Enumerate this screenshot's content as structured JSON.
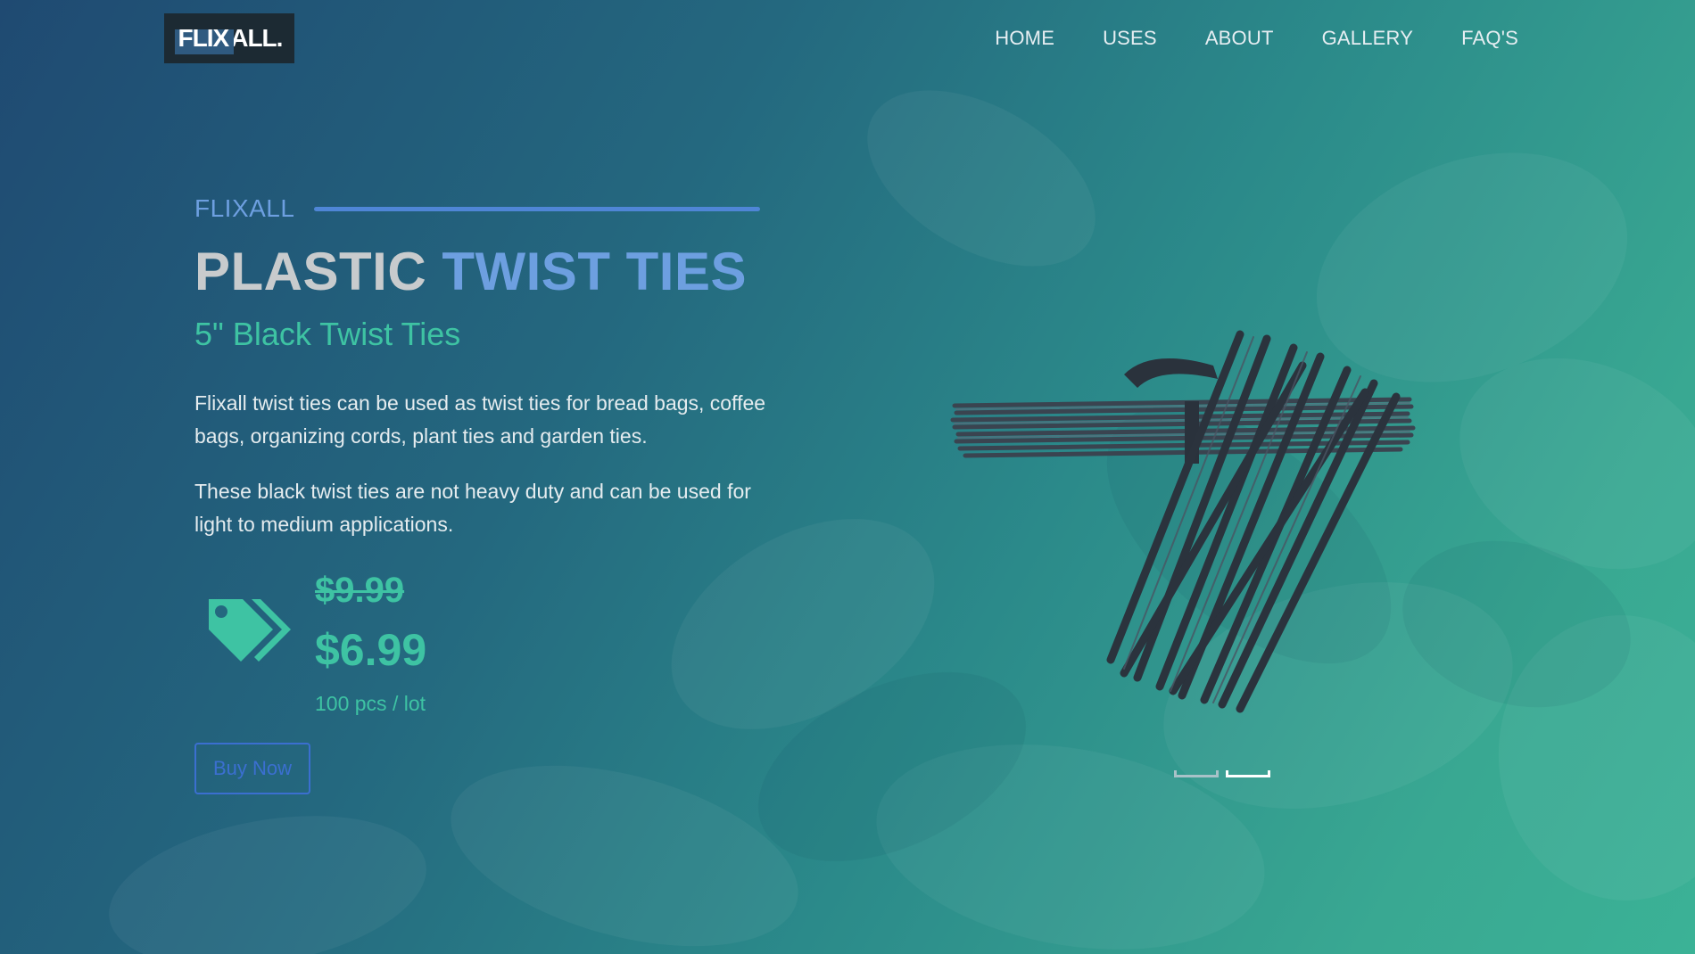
{
  "brand": {
    "logo_part1": "FLIX",
    "logo_part2": "ALL."
  },
  "nav": {
    "items": [
      {
        "label": "HOME"
      },
      {
        "label": "USES"
      },
      {
        "label": "ABOUT"
      },
      {
        "label": "GALLERY"
      },
      {
        "label": "FAQ'S"
      }
    ]
  },
  "hero": {
    "kicker": "FLIXALL",
    "title_part1": "PLASTIC ",
    "title_part2": "TWIST TIES",
    "subtitle": "5\" Black Twist Ties",
    "description_1": "Flixall twist ties can be used as twist ties for bread bags, coffee bags, organizing cords, plant ties and garden ties.",
    "description_2": "These black twist ties are not heavy duty and can be used for light to medium applications.",
    "old_price": "$9.99",
    "new_price": "$6.99",
    "quantity": "100 pcs / lot",
    "buy_label": "Buy Now"
  },
  "carousel": {
    "slides": 2,
    "active_index": 1
  },
  "colors": {
    "accent_blue": "#6d9fe0",
    "accent_green": "#3ec3a3",
    "button_blue": "#3b6fd0",
    "logo_bg": "#1c2a33"
  },
  "icons": [
    "price-tag-icon"
  ]
}
